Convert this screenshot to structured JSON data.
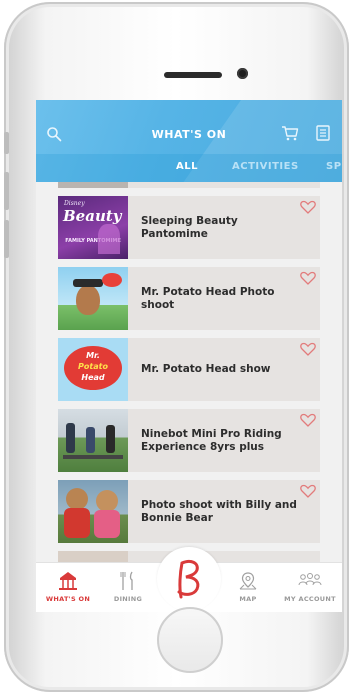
{
  "header": {
    "title": "WHAT'S ON",
    "tabs": [
      {
        "label": "ALL"
      },
      {
        "label": "ACTIVITIES"
      },
      {
        "label": "SP"
      }
    ]
  },
  "events": [
    {
      "title": "Sleeping Beauty Pantomime",
      "thumb": {
        "brand": "Disney",
        "word": "Beauty",
        "caption": "FAMILY PANTOMIME"
      }
    },
    {
      "title": "Mr. Potato Head Photo shoot"
    },
    {
      "title": "Mr. Potato Head show",
      "thumb": {
        "line1": "Mr.",
        "line2": "Potato",
        "line3": "Head"
      }
    },
    {
      "title": "Ninebot Mini Pro Riding Experience 8yrs plus"
    },
    {
      "title": "Photo shoot with Billy and Bonnie Bear"
    }
  ],
  "bottom_nav": [
    {
      "label": "WHAT'S ON",
      "icon": "carousel-icon",
      "active": true
    },
    {
      "label": "DINING",
      "icon": "cutlery-icon"
    },
    {
      "label": "",
      "icon": "butlins-logo-icon"
    },
    {
      "label": "MAP",
      "icon": "map-pin-icon"
    },
    {
      "label": "MY ACCOUNT",
      "icon": "people-icon"
    }
  ],
  "colors": {
    "header_blue": "#56b4e6",
    "accent_red": "#d93a3a",
    "card_bg": "#e6e3e1"
  }
}
